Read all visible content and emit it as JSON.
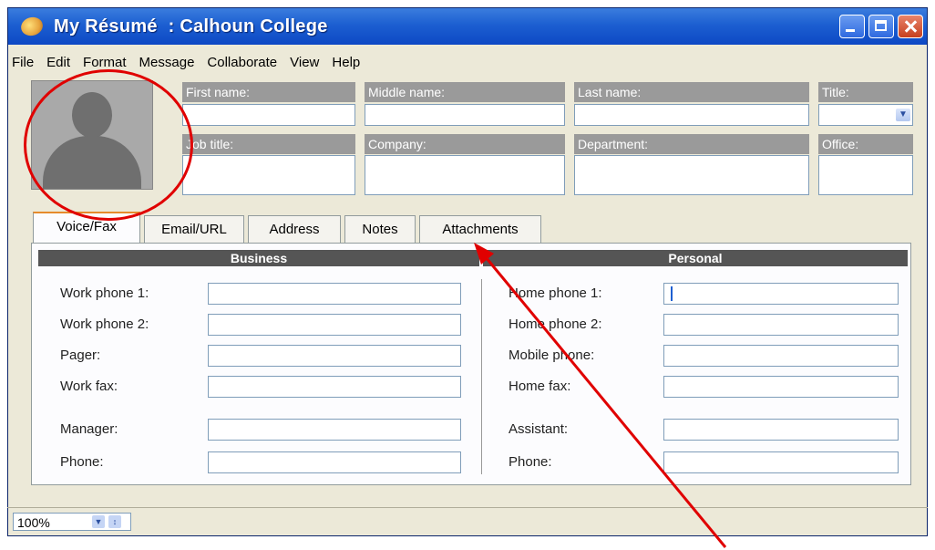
{
  "window": {
    "title": "My Résumé  : Calhoun College"
  },
  "menu": [
    "File",
    "Edit",
    "Format",
    "Message",
    "Collaborate",
    "View",
    "Help"
  ],
  "fields": {
    "first_name": "First name:",
    "middle_name": "Middle name:",
    "last_name": "Last name:",
    "title": "Title:",
    "job_title": "Job title:",
    "company": "Company:",
    "department": "Department:",
    "office": "Office:"
  },
  "tabs": [
    "Voice/Fax",
    "Email/URL",
    "Address",
    "Notes",
    "Attachments"
  ],
  "sections": {
    "business": "Business",
    "personal": "Personal"
  },
  "business_rows": [
    "Work phone 1:",
    "Work phone 2:",
    "Pager:",
    "Work fax:",
    "Manager:",
    "Phone:"
  ],
  "personal_rows": [
    "Home phone 1:",
    "Home phone 2:",
    "Mobile phone:",
    "Home fax:",
    "Assistant:",
    "Phone:"
  ],
  "status": {
    "zoom": "100%"
  },
  "colors": {
    "annotation": "#e00000",
    "titlebar": "#1c5fd1"
  },
  "icons": {
    "app": "palette-icon",
    "title_dropdown": "chevron-down-icon"
  }
}
